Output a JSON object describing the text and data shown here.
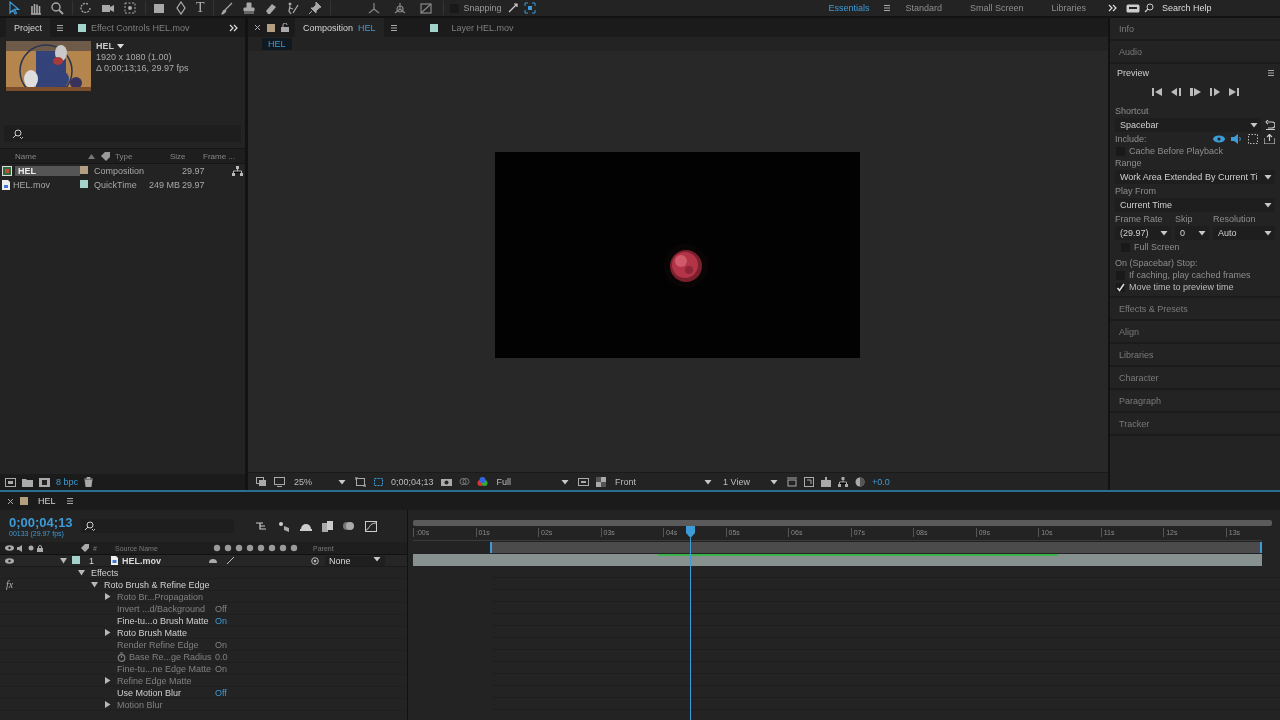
{
  "toolbar": {
    "text_tool": "T",
    "snapping": {
      "label": "Snapping",
      "checked": false
    },
    "workspaces": [
      {
        "label": "Essentials",
        "selected": true
      },
      {
        "label": "Standard",
        "selected": false
      },
      {
        "label": "Small Screen",
        "selected": false
      },
      {
        "label": "Libraries",
        "selected": false
      }
    ],
    "search": {
      "placeholder": "Search Help"
    }
  },
  "project": {
    "tabs": [
      {
        "label": "Project",
        "selected": true
      },
      {
        "label": "Effect Controls HEL.mov",
        "selected": false
      }
    ],
    "preview": {
      "name": "HEL",
      "dimensions": "1920 x 1080 (1.00)",
      "duration": "Δ 0;00;13;16, 29.97 fps"
    },
    "columns": [
      "Name",
      "Type",
      "Size",
      "Frame ..."
    ],
    "items": [
      {
        "name": "HEL",
        "kind": "composition",
        "type": "Composition",
        "frame_rate": "29.97",
        "color": "#b49e80",
        "selected": true
      },
      {
        "name": "HEL.mov",
        "kind": "footage",
        "type": "QuickTime",
        "size": "249 MB",
        "frame_rate": "29.97",
        "color": "#a3d4cb",
        "selected": false
      }
    ],
    "bit_depth": "8 bpc"
  },
  "viewer": {
    "tabs": [
      {
        "label": "Composition",
        "comp": "HEL",
        "color": "#b49e80",
        "selected": true
      },
      {
        "label": "Layer HEL.mov",
        "color": "#a3d4cb",
        "selected": false
      }
    ],
    "breadcrumb": "HEL",
    "zoom": "25%",
    "timecode": "0;00;04;13",
    "resolution": "Full",
    "view": "Front",
    "layout": "1 View",
    "exposure": "+0.0"
  },
  "side": {
    "panels_top": [
      "Info",
      "Audio"
    ],
    "preview": {
      "title": "Preview",
      "shortcut_label": "Shortcut",
      "shortcut": "Spacebar",
      "include_label": "Include:",
      "cache": {
        "label": "Cache Before Playback",
        "checked": false
      },
      "range_label": "Range",
      "range": "Work Area Extended By Current Ti",
      "play_from_label": "Play From",
      "play_from": "Current Time",
      "frame_rate_label": "Frame Rate",
      "skip_label": "Skip",
      "resolution_label": "Resolution",
      "frame_rate": "(29.97)",
      "skip": "0",
      "resolution": "Auto",
      "full_screen": {
        "label": "Full Screen",
        "checked": false
      },
      "stop_label": "On (Spacebar) Stop:",
      "stop_options": [
        {
          "label": "If caching, play cached frames",
          "checked": false
        },
        {
          "label": "Move time to preview time",
          "checked": true
        }
      ]
    },
    "panels_bottom": [
      "Effects & Presets",
      "Align",
      "Libraries",
      "Character",
      "Paragraph",
      "Tracker"
    ]
  },
  "timeline": {
    "tab": "HEL",
    "color": "#b49e80",
    "timecode": "0;00;04;13",
    "frame_info": "00133 (29.97 fps)",
    "columns": {
      "number": "#",
      "source": "Source Name",
      "parent": "Parent"
    },
    "layer": {
      "number": "1",
      "name": "HEL.mov",
      "color": "#a3d4cb",
      "parent": "None",
      "expanded": true
    },
    "tree": [
      {
        "label": "Effects",
        "expanded": true,
        "disabled": false,
        "children": [
          {
            "label": "Roto Brush & Refine Edge",
            "effect_switch": "fx",
            "expanded": true,
            "disabled": false,
            "children": [
              {
                "label": "Roto Br...Propagation",
                "expanded": false,
                "disabled": true
              },
              {
                "label": "Invert ...d/Background",
                "value": "Off",
                "disabled": true
              },
              {
                "label": "Fine-tu...o Brush Matte",
                "value": "On",
                "disabled": false
              },
              {
                "label": "Roto Brush Matte",
                "expanded": false,
                "disabled": false
              },
              {
                "label": "Render Refine Edge",
                "value": "On",
                "disabled": true
              },
              {
                "label": "Base Re...ge Radius",
                "value": "0.0",
                "stopwatch": true,
                "disabled": true
              },
              {
                "label": "Fine-tu...ne Edge Matte",
                "value": "On",
                "disabled": true
              },
              {
                "label": "Refine Edge Matte",
                "expanded": false,
                "disabled": true
              },
              {
                "label": "Use Motion Blur",
                "value": "Off",
                "disabled": false
              },
              {
                "label": "Motion Blur",
                "expanded": false,
                "disabled": true
              }
            ]
          }
        ]
      }
    ],
    "ruler": [
      ":00s",
      "01s",
      "02s",
      "03s",
      "04s",
      "05s",
      "06s",
      "07s",
      "08s",
      "09s",
      "10s",
      "11s",
      "12s",
      "13s"
    ],
    "playhead": {
      "level": 0.326
    }
  }
}
